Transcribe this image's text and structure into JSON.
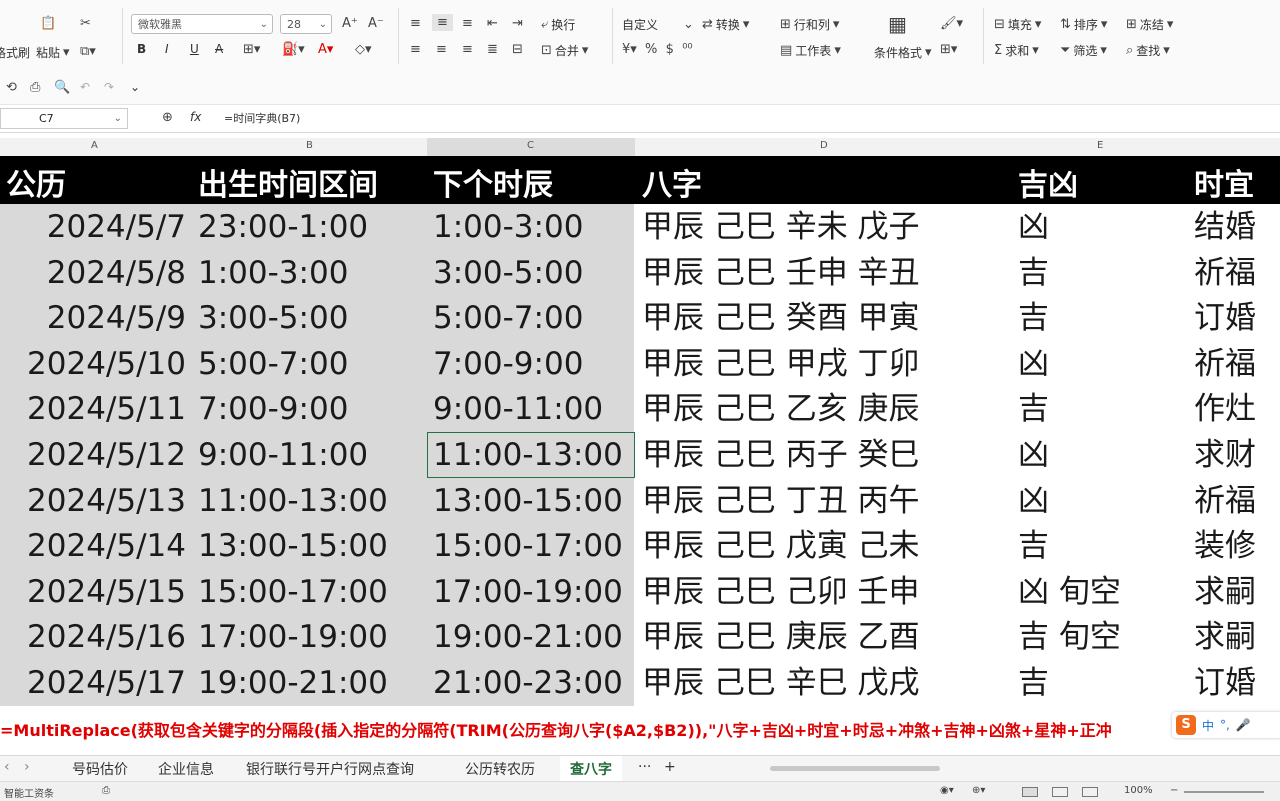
{
  "ribbon": {
    "format_painter": "格式刷",
    "paste": "粘贴",
    "font_name": "微软雅黑",
    "font_size": "28",
    "wrap": "换行",
    "merge": "合并",
    "number_format": "自定义",
    "convert": "转换",
    "rows_cols": "行和列",
    "worksheet": "工作表",
    "cond_format": "条件格式",
    "fill": "填充",
    "sort": "排序",
    "freeze": "冻结",
    "sum": "求和",
    "filter": "筛选",
    "find": "查找"
  },
  "formula_bar": {
    "cell_ref": "C7",
    "fx": "fx",
    "formula": "=时间字典(B7)"
  },
  "columns": [
    "A",
    "B",
    "C",
    "D",
    "E"
  ],
  "headers": {
    "a": "公历",
    "b": "出生时间区间",
    "c": "下个时辰",
    "d": "八字",
    "e": "吉凶",
    "f": "时宜"
  },
  "rows": [
    {
      "date": "2024/5/7",
      "range": "23:00-1:00",
      "next": "1:00-3:00",
      "bazi": "甲辰 己巳 辛未 戊子",
      "jx": "凶",
      "yi": "结婚"
    },
    {
      "date": "2024/5/8",
      "range": "1:00-3:00",
      "next": "3:00-5:00",
      "bazi": "甲辰 己巳 壬申 辛丑",
      "jx": "吉",
      "yi": "祈福"
    },
    {
      "date": "2024/5/9",
      "range": "3:00-5:00",
      "next": "5:00-7:00",
      "bazi": "甲辰 己巳 癸酉 甲寅",
      "jx": "吉",
      "yi": "订婚"
    },
    {
      "date": "2024/5/10",
      "range": "5:00-7:00",
      "next": "7:00-9:00",
      "bazi": "甲辰 己巳 甲戌 丁卯",
      "jx": "凶",
      "yi": "祈福"
    },
    {
      "date": "2024/5/11",
      "range": "7:00-9:00",
      "next": "9:00-11:00",
      "bazi": "甲辰 己巳 乙亥 庚辰",
      "jx": "吉",
      "yi": "作灶"
    },
    {
      "date": "2024/5/12",
      "range": "9:00-11:00",
      "next": "11:00-13:00",
      "bazi": "甲辰 己巳 丙子 癸巳",
      "jx": "凶",
      "yi": "求财"
    },
    {
      "date": "2024/5/13",
      "range": "11:00-13:00",
      "next": "13:00-15:00",
      "bazi": "甲辰 己巳 丁丑 丙午",
      "jx": "凶",
      "yi": "祈福"
    },
    {
      "date": "2024/5/14",
      "range": "13:00-15:00",
      "next": "15:00-17:00",
      "bazi": "甲辰 己巳 戊寅 己未",
      "jx": "吉",
      "yi": "装修"
    },
    {
      "date": "2024/5/15",
      "range": "15:00-17:00",
      "next": "17:00-19:00",
      "bazi": "甲辰 己巳 己卯 壬申",
      "jx": "凶 旬空",
      "yi": "求嗣"
    },
    {
      "date": "2024/5/16",
      "range": "17:00-19:00",
      "next": "19:00-21:00",
      "bazi": "甲辰 己巳 庚辰 乙酉",
      "jx": "吉 旬空",
      "yi": "求嗣"
    },
    {
      "date": "2024/5/17",
      "range": "19:00-21:00",
      "next": "21:00-23:00",
      "bazi": "甲辰 己巳 辛巳 戊戌",
      "jx": "吉",
      "yi": "订婚"
    }
  ],
  "overlay_formula": "=MultiReplace(获取包含关键字的分隔段(插入指定的分隔符(TRIM(公历查询八字($A2,$B2)),\"八字+吉凶+时宜+时忌+冲煞+吉神+凶煞+星神+正冲",
  "ime": {
    "logo": "S",
    "lang": "中"
  },
  "sheet_tabs": [
    "号码估价",
    "企业信息",
    "银行联行号开户行网点查询",
    "公历转农历",
    "查八字"
  ],
  "sheet_tabs_more": "···",
  "sheet_tabs_add": "+",
  "status": {
    "left": "智能工资条",
    "zoom": "100%"
  },
  "colors": {
    "header_bg": "#000000",
    "grey_fill": "#d9d9d9",
    "formula_text": "#e00000",
    "selection": "#217346"
  }
}
